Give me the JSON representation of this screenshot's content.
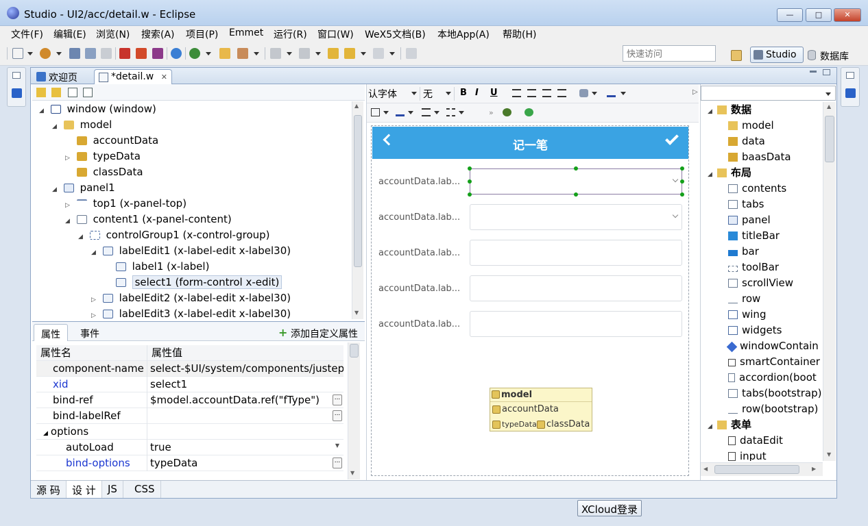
{
  "window": {
    "title": "Studio - UI2/acc/detail.w - Eclipse",
    "controls": {
      "minimize": "—",
      "maximize": "□",
      "close": "✕"
    }
  },
  "menubar": {
    "items": [
      "文件(F)",
      "编辑(E)",
      "浏览(N)",
      "搜索(A)",
      "项目(P)",
      "Emmet",
      "运行(R)",
      "窗口(W)",
      "WeX5文档(B)",
      "本地App(A)",
      "帮助(H)"
    ]
  },
  "toolbar": {
    "quick_access_placeholder": "快速访问",
    "perspectives": {
      "studio": "Studio",
      "database": "数据库"
    }
  },
  "editor_tabs": [
    {
      "label": "欢迎页"
    },
    {
      "label": "*detail.w",
      "close": "✕"
    }
  ],
  "outline": {
    "tree": [
      {
        "label": "window (window)",
        "twisty": "◢"
      },
      {
        "label": "model",
        "twisty": "◢"
      },
      {
        "label": "accountData",
        "twisty": ""
      },
      {
        "label": "typeData",
        "twisty": "▷"
      },
      {
        "label": "classData",
        "twisty": ""
      },
      {
        "label": "panel1",
        "twisty": "◢"
      },
      {
        "label": "top1 (x-panel-top)",
        "twisty": "▷"
      },
      {
        "label": "content1 (x-panel-content)",
        "twisty": "◢"
      },
      {
        "label": "controlGroup1 (x-control-group)",
        "twisty": "◢"
      },
      {
        "label": "labelEdit1 (x-label-edit x-label30)",
        "twisty": "◢"
      },
      {
        "label": "label1 (x-label)",
        "twisty": ""
      },
      {
        "label": "select1 (form-control x-edit)",
        "twisty": ""
      },
      {
        "label": "labelEdit2 (x-label-edit x-label30)",
        "twisty": "▷"
      },
      {
        "label": "labelEdit3 (x-label-edit x-label30)",
        "twisty": "▷"
      }
    ]
  },
  "properties": {
    "tabs": [
      "属性",
      "事件"
    ],
    "add_custom": "添加自定义属性",
    "header": {
      "name": "属性名",
      "value": "属性值"
    },
    "rows": [
      {
        "name": "component-name",
        "value": "select-$UI/system/components/justep/"
      },
      {
        "name": "xid",
        "value": "select1"
      },
      {
        "name": "bind-ref",
        "value": "$model.accountData.ref(\"fType\")",
        "button": "..."
      },
      {
        "name": "bind-labelRef",
        "value": "",
        "button": "..."
      },
      {
        "name": "options",
        "value": "",
        "twisty": "◢"
      },
      {
        "name": "autoLoad",
        "value": "true",
        "dropdown": "▼"
      },
      {
        "name": "bind-options",
        "value": "typeData",
        "button": "..."
      }
    ]
  },
  "bottom_tabs": [
    "源 码",
    "设 计",
    "JS",
    "CSS"
  ],
  "designer": {
    "font_select": "认字体",
    "size_select": "无",
    "format_buttons": {
      "bold": "B",
      "italic": "I",
      "underline": "U"
    },
    "mobile": {
      "title": "记一笔",
      "form_labels": [
        "accountData.lab...",
        "accountData.lab...",
        "accountData.lab...",
        "accountData.lab...",
        "accountData.lab..."
      ]
    },
    "model_box": {
      "title": "model",
      "items": [
        "accountData",
        "typeData",
        "classData"
      ]
    }
  },
  "palette": {
    "groups": [
      {
        "label": "数据",
        "items": [
          "model",
          "data",
          "baasData"
        ]
      },
      {
        "label": "布局",
        "items": [
          "contents",
          "tabs",
          "panel",
          "titleBar",
          "bar",
          "toolBar",
          "scrollView",
          "row",
          "wing",
          "widgets",
          "windowContain",
          "smartContainer",
          "accordion(boot",
          "tabs(bootstrap)",
          "row(bootstrap)"
        ]
      },
      {
        "label": "表单",
        "items": [
          "dataEdit",
          "input"
        ]
      }
    ]
  },
  "status": {
    "xcloud": "XCloud登录"
  },
  "scroll": {
    "arrow_up": "▲",
    "arrow_down": "▼",
    "arrow_left": "◀",
    "arrow_right": "▶"
  }
}
